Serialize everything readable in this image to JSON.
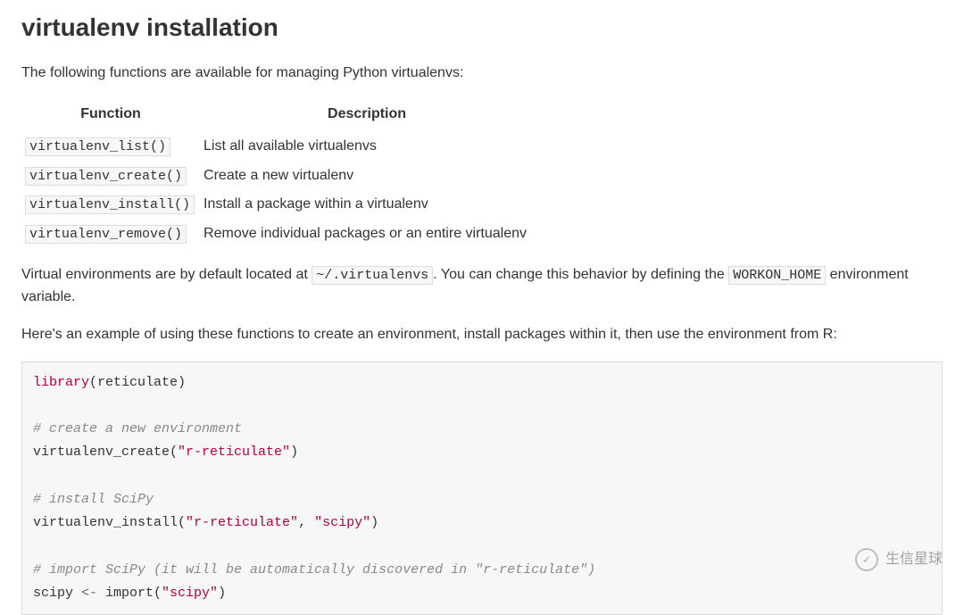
{
  "title": "virtualenv installation",
  "intro": "The following functions are available for managing Python virtualenvs:",
  "table": {
    "headers": {
      "func": "Function",
      "desc": "Description"
    },
    "rows": [
      {
        "func": "virtualenv_list()",
        "desc": "List all available virtualenvs"
      },
      {
        "func": "virtualenv_create()",
        "desc": "Create a new virtualenv"
      },
      {
        "func": "virtualenv_install()",
        "desc": "Install a package within a virtualenv"
      },
      {
        "func": "virtualenv_remove()",
        "desc": "Remove individual packages or an entire virtualenv"
      }
    ]
  },
  "para2": {
    "pre": "Virtual environments are by default located at ",
    "code1": "~/.virtualenvs",
    "mid": ". You can change this behavior by defining the ",
    "code2": "WORKON_HOME",
    "post": " environment variable."
  },
  "para3": "Here's an example of using these functions to create an environment, install packages within it, then use the environment from R:",
  "code": {
    "l1_kw": "library",
    "l1_rest": "(reticulate)",
    "c1": "# create a new environment",
    "l2_fn": "virtualenv_create(",
    "l2_str": "\"r-reticulate\"",
    "l2_end": ")",
    "c2": "# install SciPy",
    "l3_fn": "virtualenv_install(",
    "l3_str1": "\"r-reticulate\"",
    "l3_sep": ", ",
    "l3_str2": "\"scipy\"",
    "l3_end": ")",
    "c3": "# import SciPy (it will be automatically discovered in \"r-reticulate\")",
    "l4_var": "scipy ",
    "l4_op": "<-",
    "l4_fn": " import(",
    "l4_str": "\"scipy\"",
    "l4_end": ")"
  },
  "watermark": "生信星球"
}
